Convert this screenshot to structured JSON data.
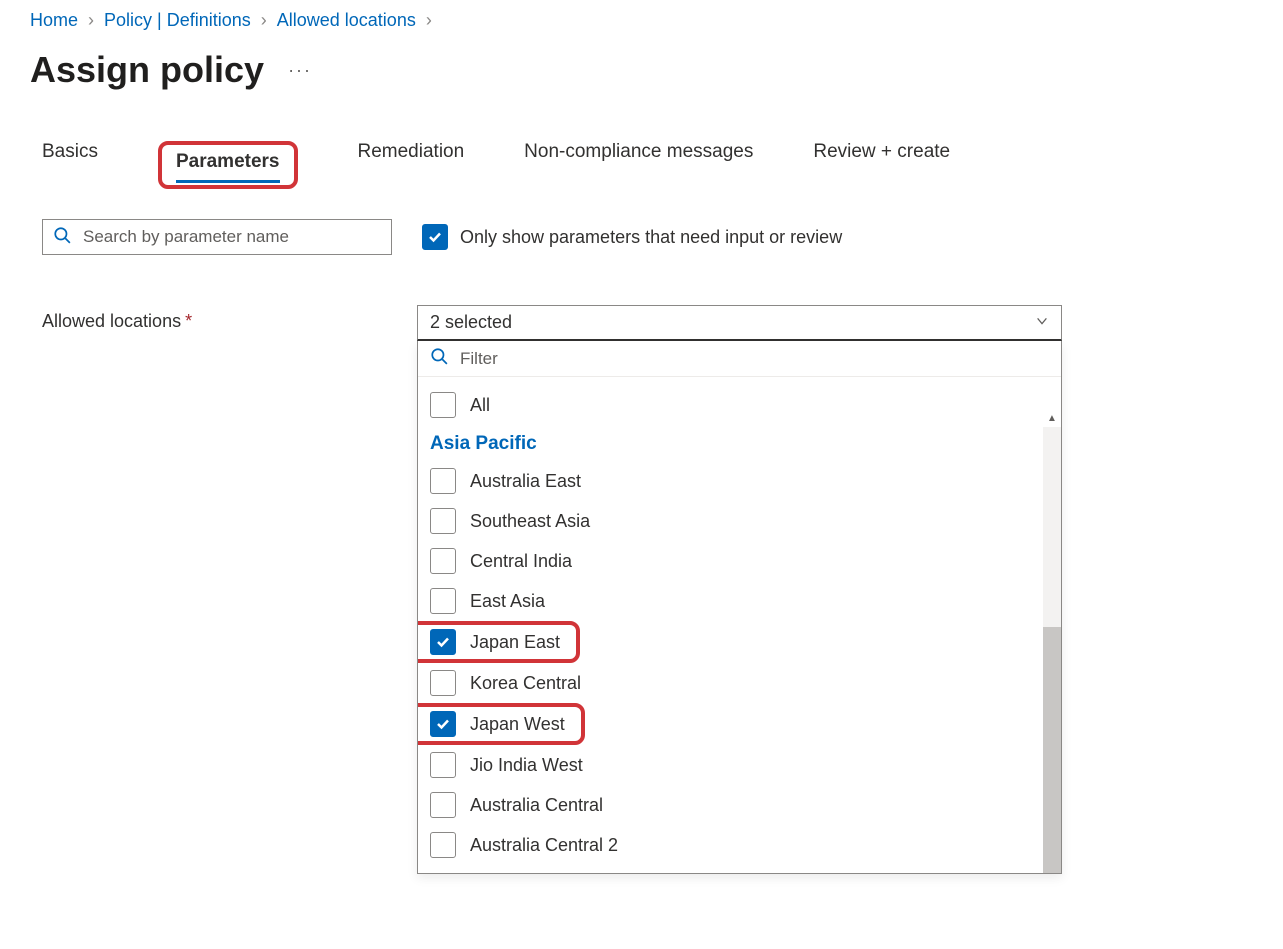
{
  "breadcrumb": {
    "items": [
      {
        "label": "Home"
      },
      {
        "label": "Policy | Definitions"
      },
      {
        "label": "Allowed locations"
      }
    ]
  },
  "page": {
    "title": "Assign policy"
  },
  "tabs": {
    "items": [
      {
        "label": "Basics",
        "active": false
      },
      {
        "label": "Parameters",
        "active": true,
        "highlighted": true
      },
      {
        "label": "Remediation",
        "active": false
      },
      {
        "label": "Non-compliance messages",
        "active": false
      },
      {
        "label": "Review + create",
        "active": false
      }
    ]
  },
  "search": {
    "placeholder": "Search by parameter name"
  },
  "filter_checkbox": {
    "checked": true,
    "label": "Only show parameters that need input or review"
  },
  "param": {
    "label": "Allowed locations",
    "required": true
  },
  "dropdown": {
    "selected_summary": "2 selected",
    "filter_placeholder": "Filter",
    "all_label": "All",
    "group_label": "Asia Pacific",
    "options": [
      {
        "label": "Australia East",
        "checked": false,
        "highlighted": false
      },
      {
        "label": "Southeast Asia",
        "checked": false,
        "highlighted": false
      },
      {
        "label": "Central India",
        "checked": false,
        "highlighted": false
      },
      {
        "label": "East Asia",
        "checked": false,
        "highlighted": false
      },
      {
        "label": "Japan East",
        "checked": true,
        "highlighted": true
      },
      {
        "label": "Korea Central",
        "checked": false,
        "highlighted": false
      },
      {
        "label": "Japan West",
        "checked": true,
        "highlighted": true
      },
      {
        "label": "Jio India West",
        "checked": false,
        "highlighted": false
      },
      {
        "label": "Australia Central",
        "checked": false,
        "highlighted": false
      },
      {
        "label": "Australia Central 2",
        "checked": false,
        "highlighted": false
      }
    ]
  },
  "colors": {
    "link": "#0067b8",
    "highlight_border": "#d13438",
    "checkbox_checked": "#0067b8"
  }
}
